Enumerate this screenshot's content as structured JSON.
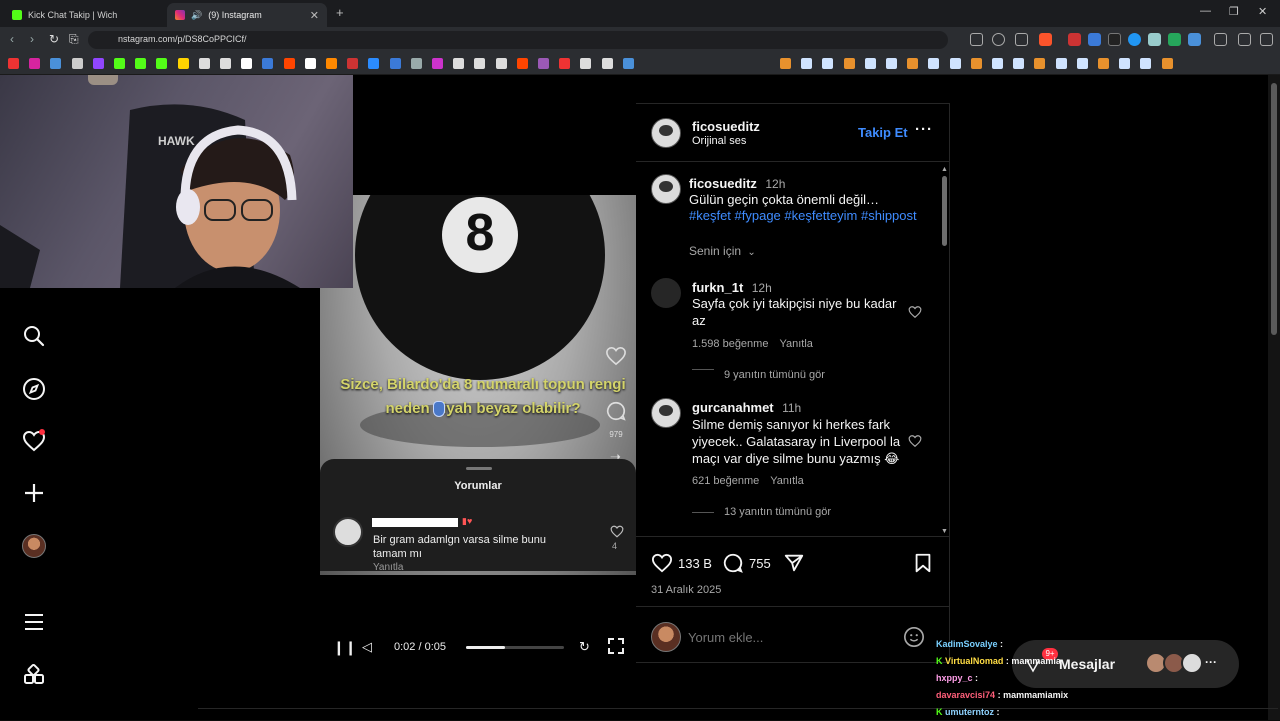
{
  "browser": {
    "tabs": [
      {
        "title": "Kick Chat Takip | Wich",
        "active": false
      },
      {
        "title": "(9) Instagram",
        "active": true
      }
    ],
    "url": "nstagram.com/p/DS8CoPPCICf/"
  },
  "post": {
    "author": "ficosueditz",
    "audio": "Orijinal ses",
    "follow_label": "Takip Et",
    "caption_author": "ficosueditz",
    "caption_time": "12h",
    "caption_text": "Gülün geçin çokta önemli değil…",
    "hashtags": "#keşfet #fypage #keşfetteyim #shippost",
    "filter_label": "Senin için",
    "likes": "133 B",
    "comments_count": "755",
    "date": "31 Aralık 2025",
    "add_comment_placeholder": "Yorum ekle..."
  },
  "comments": [
    {
      "user": "furkn_1t",
      "time": "12h",
      "text": "Sayfa çok iyi takipçisi niye bu kadar az",
      "likes": "1.598 beğenme",
      "reply": "Yanıtla",
      "view_replies": "9 yanıtın tümünü gör"
    },
    {
      "user": "gurcanahmet",
      "time": "11h",
      "text": "Silme demiş sanıyor ki herkes fark yiyecek.. Galatasaray in Liverpool la maçı var diye silme bunu yazmış 😂",
      "likes": "621 beğenme",
      "reply": "Yanıtla",
      "view_replies": "13 yanıtın tümünü gör"
    }
  ],
  "video": {
    "overlay_text": "Sizce, Bilardo'da 8 numaralı topun rengi neden siyah beyaz olabilir?",
    "comments_stat": "979",
    "sheet_title": "Yorumlar",
    "inner_comment_text": "Bir gram adamlgn varsa silme bunu tamam mı",
    "inner_comment_reply": "Yanıtla",
    "inner_comment_likes": "4",
    "time": "0:02 / 0:05",
    "progress": 0.4
  },
  "messages_label": "Mesajlar",
  "messages_badge": "9+",
  "chat": [
    {
      "user": "KadimSovalye",
      "msg": "",
      "color": "#7ad0ff"
    },
    {
      "user": "VirtualNomad",
      "msg": "mammamia",
      "color": "#ffdd44"
    },
    {
      "user": "hxppy_c",
      "msg": "",
      "color": "#ff9ee8"
    },
    {
      "user": "davaravcisi74",
      "msg": "mammamiamix",
      "color": "#ff5f7a"
    },
    {
      "user": "umuterntoz",
      "msg": "",
      "color": "#8fd3ff"
    }
  ],
  "colors": {
    "accent": "#3f8cff",
    "notify": "#ff3040"
  }
}
